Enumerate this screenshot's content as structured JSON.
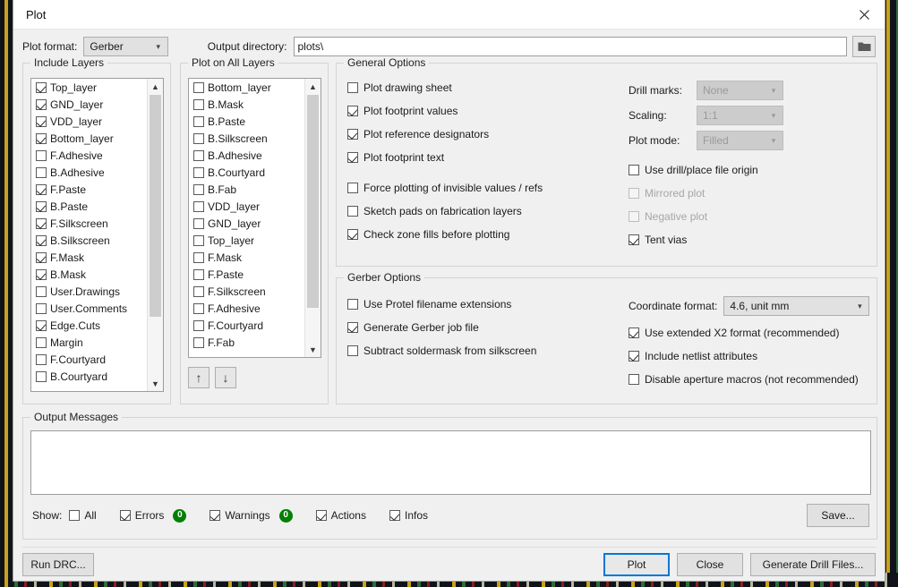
{
  "window": {
    "title": "Plot",
    "close_icon": "close-icon"
  },
  "top": {
    "plot_format_label": "Plot format:",
    "plot_format_value": "Gerber",
    "output_dir_label": "Output directory:",
    "output_dir_value": "plots\\",
    "output_dir_placeholder": "",
    "browse_icon": "folder-icon"
  },
  "include_layers": {
    "title": "Include Layers",
    "items": [
      {
        "label": "Top_layer",
        "checked": true
      },
      {
        "label": "GND_layer",
        "checked": true
      },
      {
        "label": "VDD_layer",
        "checked": true
      },
      {
        "label": "Bottom_layer",
        "checked": true
      },
      {
        "label": "F.Adhesive",
        "checked": false
      },
      {
        "label": "B.Adhesive",
        "checked": false
      },
      {
        "label": "F.Paste",
        "checked": true
      },
      {
        "label": "B.Paste",
        "checked": true
      },
      {
        "label": "F.Silkscreen",
        "checked": true
      },
      {
        "label": "B.Silkscreen",
        "checked": true
      },
      {
        "label": "F.Mask",
        "checked": true
      },
      {
        "label": "B.Mask",
        "checked": true
      },
      {
        "label": "User.Drawings",
        "checked": false
      },
      {
        "label": "User.Comments",
        "checked": false
      },
      {
        "label": "Edge.Cuts",
        "checked": true
      },
      {
        "label": "Margin",
        "checked": false
      },
      {
        "label": "F.Courtyard",
        "checked": false
      },
      {
        "label": "B.Courtyard",
        "checked": false
      }
    ],
    "scroll_up_icon": "chevron-up-icon",
    "scroll_down_icon": "chevron-down-icon"
  },
  "plot_on_all_layers": {
    "title": "Plot on All Layers",
    "items": [
      {
        "label": "Bottom_layer",
        "checked": false
      },
      {
        "label": "B.Mask",
        "checked": false
      },
      {
        "label": "B.Paste",
        "checked": false
      },
      {
        "label": "B.Silkscreen",
        "checked": false
      },
      {
        "label": "B.Adhesive",
        "checked": false
      },
      {
        "label": "B.Courtyard",
        "checked": false
      },
      {
        "label": "B.Fab",
        "checked": false
      },
      {
        "label": "VDD_layer",
        "checked": false
      },
      {
        "label": "GND_layer",
        "checked": false
      },
      {
        "label": "Top_layer",
        "checked": false
      },
      {
        "label": "F.Mask",
        "checked": false
      },
      {
        "label": "F.Paste",
        "checked": false
      },
      {
        "label": "F.Silkscreen",
        "checked": false
      },
      {
        "label": "F.Adhesive",
        "checked": false
      },
      {
        "label": "F.Courtyard",
        "checked": false
      },
      {
        "label": "F.Fab",
        "checked": false
      }
    ],
    "move_up_icon": "arrow-up-icon",
    "move_down_icon": "arrow-down-icon",
    "scroll_up_icon": "chevron-up-icon",
    "scroll_down_icon": "chevron-down-icon"
  },
  "general_options": {
    "title": "General Options",
    "left_options": [
      {
        "label": "Plot drawing sheet",
        "checked": false,
        "enabled": true
      },
      {
        "label": "Plot footprint values",
        "checked": true,
        "enabled": true
      },
      {
        "label": "Plot reference designators",
        "checked": true,
        "enabled": true
      },
      {
        "label": "Plot footprint text",
        "checked": true,
        "enabled": true
      },
      {
        "label": "Force plotting of invisible values / refs",
        "checked": false,
        "enabled": true
      },
      {
        "label": "Sketch pads on fabrication layers",
        "checked": false,
        "enabled": true
      },
      {
        "label": "Check zone fills before plotting",
        "checked": true,
        "enabled": true
      }
    ],
    "drill_marks_label": "Drill marks:",
    "drill_marks_value": "None",
    "scaling_label": "Scaling:",
    "scaling_value": "1:1",
    "plot_mode_label": "Plot mode:",
    "plot_mode_value": "Filled",
    "right_options": [
      {
        "label": "Use drill/place file origin",
        "checked": false,
        "enabled": true
      },
      {
        "label": "Mirrored plot",
        "checked": false,
        "enabled": false
      },
      {
        "label": "Negative plot",
        "checked": false,
        "enabled": false
      },
      {
        "label": "Tent vias",
        "checked": true,
        "enabled": true
      }
    ]
  },
  "gerber_options": {
    "title": "Gerber Options",
    "left_options": [
      {
        "label": "Use Protel filename extensions",
        "checked": false,
        "enabled": true
      },
      {
        "label": "Generate Gerber job file",
        "checked": true,
        "enabled": true
      },
      {
        "label": "Subtract soldermask from silkscreen",
        "checked": false,
        "enabled": true
      }
    ],
    "coordinate_format_label": "Coordinate format:",
    "coordinate_format_value": "4.6, unit mm",
    "right_options": [
      {
        "label": "Use extended X2 format (recommended)",
        "checked": true,
        "enabled": true
      },
      {
        "label": "Include netlist attributes",
        "checked": true,
        "enabled": true
      },
      {
        "label": "Disable aperture macros (not recommended)",
        "checked": false,
        "enabled": true
      }
    ]
  },
  "output_messages": {
    "title": "Output Messages",
    "content": "",
    "show_label": "Show:",
    "filters": [
      {
        "label": "All",
        "checked": false,
        "badge": null
      },
      {
        "label": "Errors",
        "checked": true,
        "badge": "0"
      },
      {
        "label": "Warnings",
        "checked": true,
        "badge": "0"
      },
      {
        "label": "Actions",
        "checked": true,
        "badge": null
      },
      {
        "label": "Infos",
        "checked": true,
        "badge": null
      }
    ],
    "save_label": "Save..."
  },
  "footer": {
    "run_drc_label": "Run DRC...",
    "plot_label": "Plot",
    "close_label": "Close",
    "generate_drill_label": "Generate Drill Files..."
  },
  "colors": {
    "accent": "#0078d7",
    "badge_green": "#008000",
    "dialog_bg": "#f0f0f0",
    "field_bg": "#ffffff"
  }
}
